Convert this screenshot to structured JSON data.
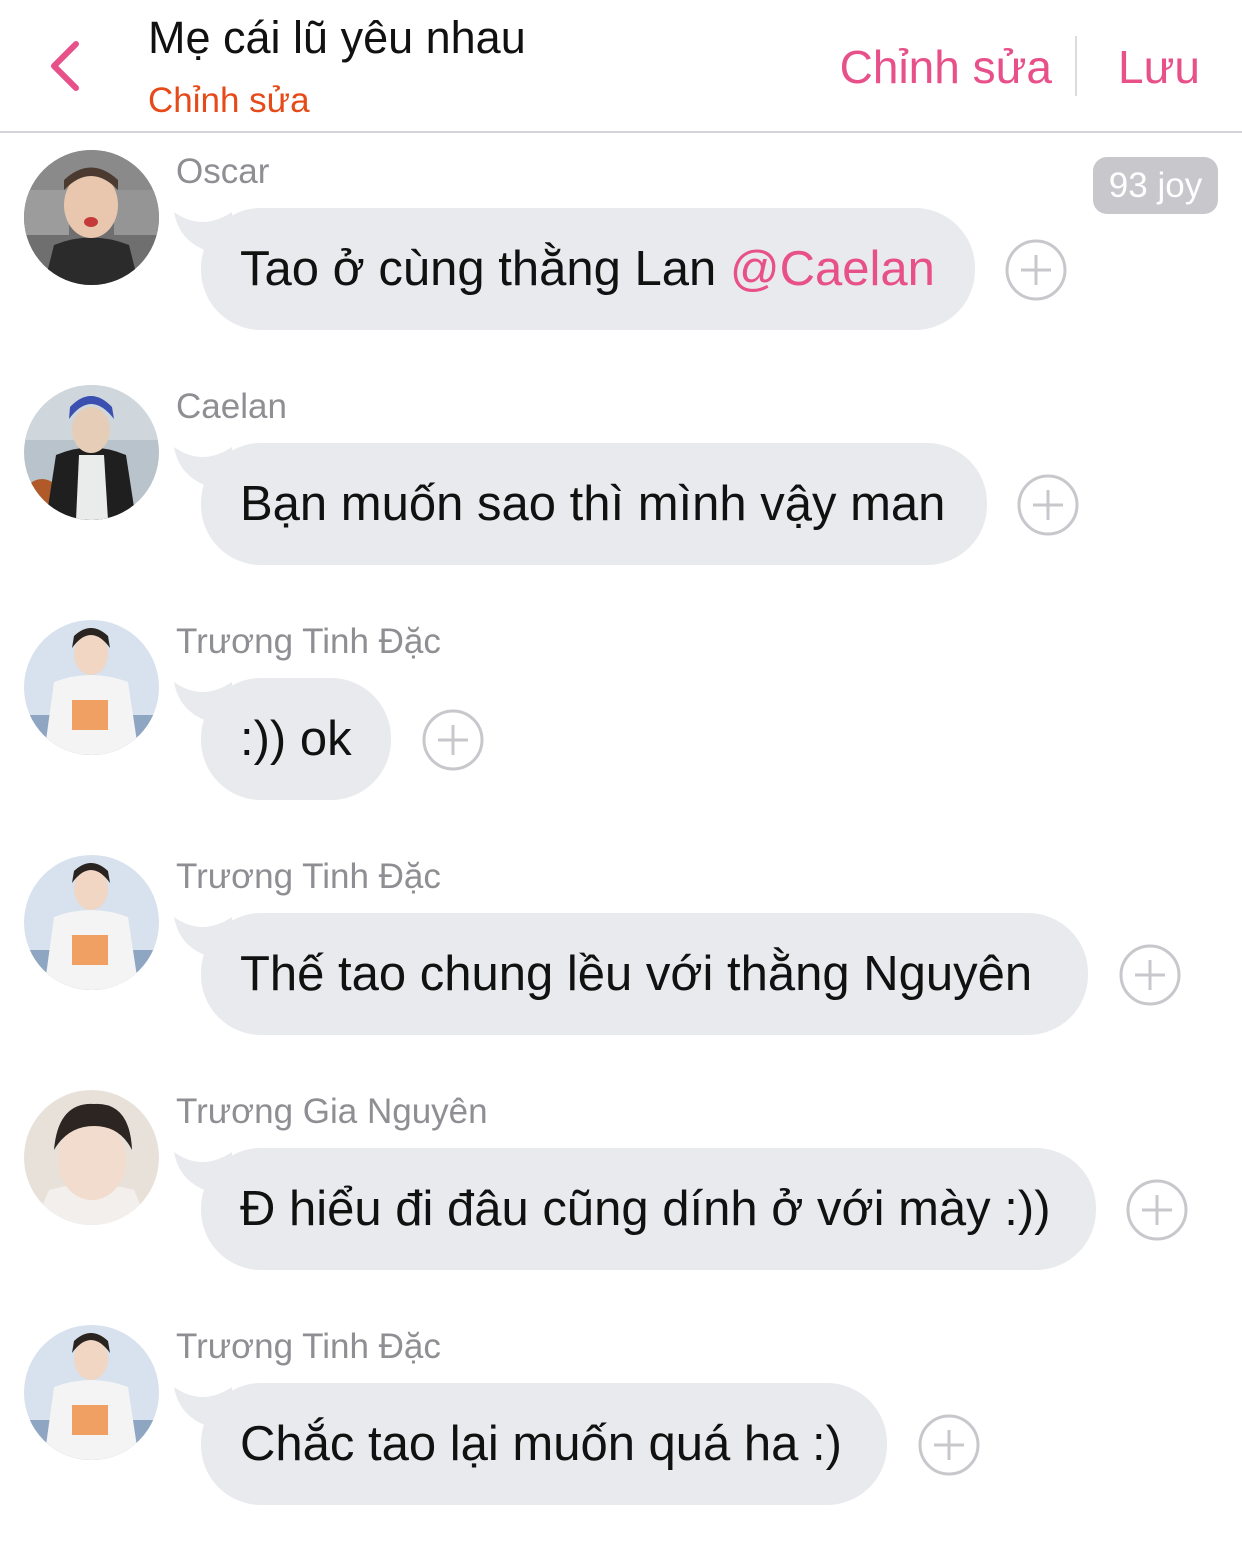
{
  "header": {
    "title": "Mẹ cái lũ yêu nhau",
    "subtitle": "Chỉnh sửa",
    "edit_label": "Chỉnh sửa",
    "save_label": "Lưu",
    "back_icon": "chevron-left-icon",
    "accent_color": "#e8508a",
    "subtitle_color": "#e64a19"
  },
  "badge": {
    "label": "93 joy"
  },
  "messages": [
    {
      "sender": "Oscar",
      "text": "Tao ở cùng thằng Lan ",
      "mention": "@Caelan",
      "react_icon": "plus-circle-icon"
    },
    {
      "sender": "Caelan",
      "text": "Bạn muốn sao thì mình vậy man",
      "react_icon": "plus-circle-icon"
    },
    {
      "sender": "Trương Tinh Đặc",
      "text": ":)) ok",
      "react_icon": "plus-circle-icon"
    },
    {
      "sender": "Trương Tinh Đặc",
      "text": "Thế tao chung lều với thằng Nguyên",
      "react_icon": "plus-circle-icon"
    },
    {
      "sender": "Trương Gia Nguyên",
      "text": "Đ hiểu đi đâu cũng dính ở với mày :))",
      "react_icon": "plus-circle-icon"
    },
    {
      "sender": "Trương Tinh Đặc",
      "text": "Chắc tao lại muốn quá ha :)",
      "react_icon": "plus-circle-icon"
    }
  ],
  "colors": {
    "bubble": "#e9eaed",
    "sender": "#8e8e93",
    "badge": "#c7c7cc"
  }
}
